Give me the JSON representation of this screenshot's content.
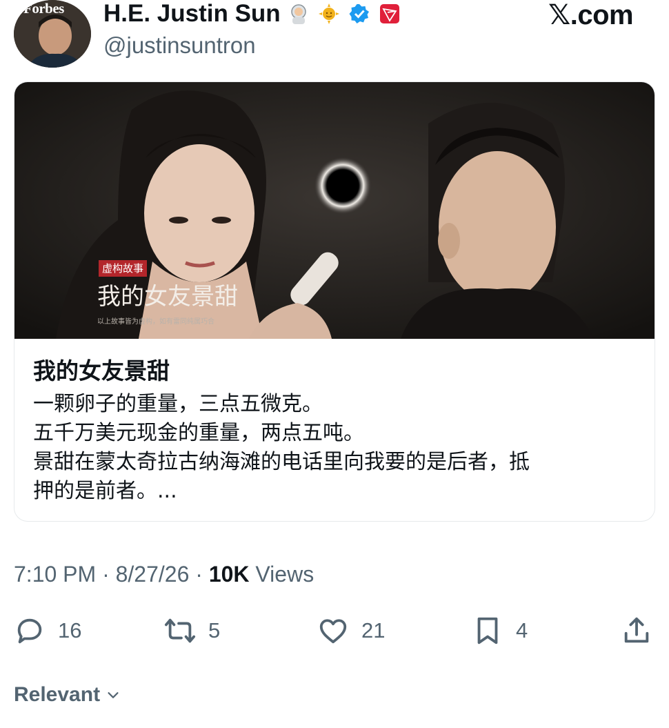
{
  "author": {
    "display_name": "H.E. Justin Sun",
    "handle": "@justinsuntron",
    "avatar_text": "Forbes",
    "badges": [
      "astronaut-emoji",
      "sun-emoji",
      "verified-icon",
      "tron-logo-icon"
    ]
  },
  "site_label": "𝕏.com",
  "card": {
    "image_title": "我的女友景甜",
    "image_tag": "虚构故事",
    "image_caption": "以上故事皆为虚构，如有雷同纯属巧合",
    "title": "我的女友景甜",
    "description_lines": [
      "一颗卵子的重量，三点五微克。",
      "五千万美元现金的重量，两点五吨。",
      "景甜在蒙太奇拉古纳海滩的电话里向我要的是后者，抵",
      "押的是前者。..."
    ]
  },
  "meta": {
    "time": "7:10 PM",
    "date": "8/27/26",
    "views_count": "10K",
    "views_label": "Views"
  },
  "actions": {
    "replies": "16",
    "reposts": "5",
    "likes": "21",
    "bookmarks": "4"
  },
  "sort": {
    "label": "Relevant"
  },
  "colors": {
    "text": "#0f1419",
    "muted": "#536471",
    "verified": "#1d9bf0",
    "tron": "#e0203a"
  }
}
